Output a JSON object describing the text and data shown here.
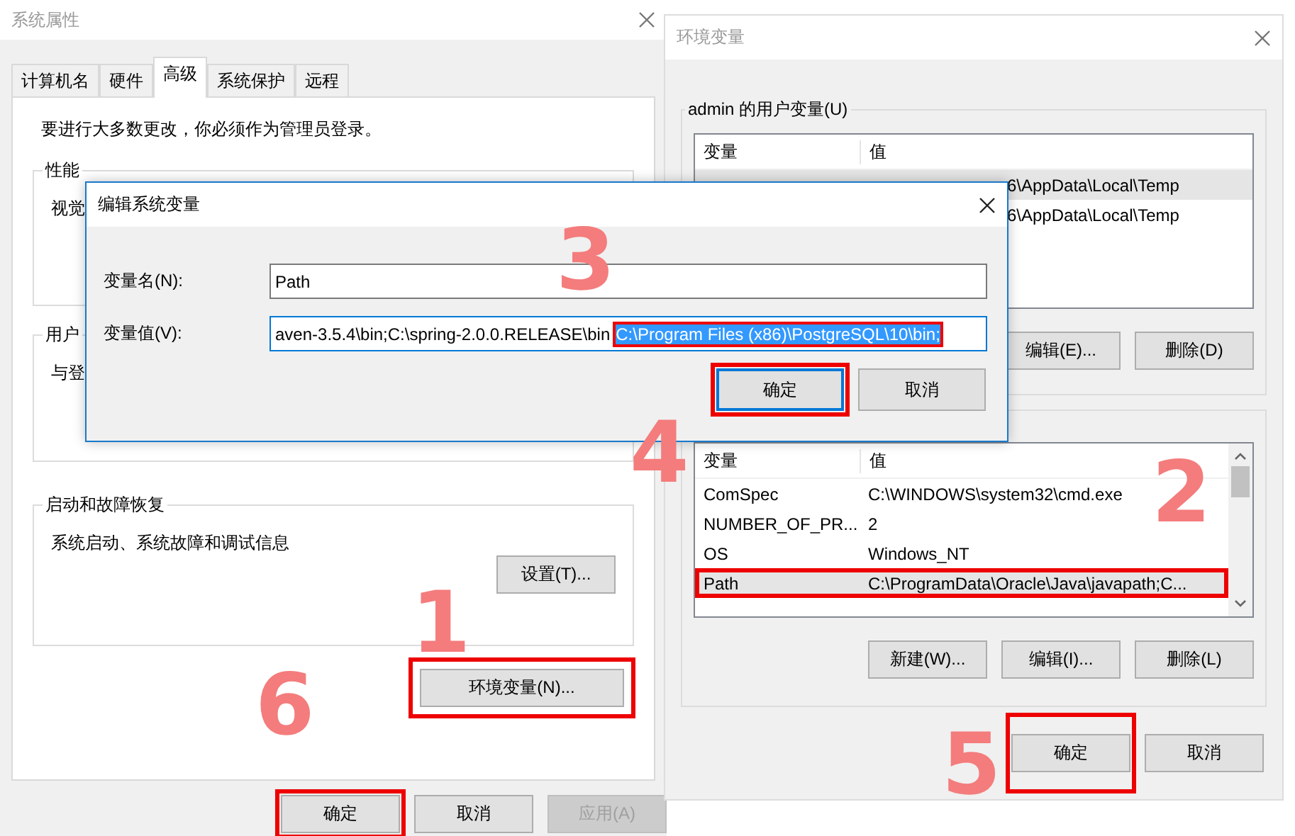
{
  "system_properties": {
    "title": "系统属性",
    "tabs": [
      {
        "label": "计算机名",
        "selected": false
      },
      {
        "label": "硬件",
        "selected": false
      },
      {
        "label": "高级",
        "selected": true
      },
      {
        "label": "系统保护",
        "selected": false
      },
      {
        "label": "远程",
        "selected": false
      }
    ],
    "admin_note": "要进行大多数更改，你必须作为管理员登录。",
    "performance": {
      "title": "性能",
      "text": "视觉"
    },
    "user_profiles": {
      "title": "用户",
      "text": "与登"
    },
    "startup_recovery": {
      "title": "启动和故障恢复",
      "text": "系统启动、系统故障和调试信息",
      "button": "设置(T)..."
    },
    "env_button": {
      "label": "环境变量(N)...",
      "highlighted": true,
      "step": "1"
    },
    "buttons": [
      {
        "label": "确定",
        "disabled": false,
        "highlighted": true,
        "step": "6"
      },
      {
        "label": "取消",
        "disabled": false,
        "highlighted": false
      },
      {
        "label": "应用(A)",
        "disabled": true,
        "highlighted": false
      }
    ]
  },
  "environment_variables": {
    "title": "环境变量",
    "user_group": {
      "title": "admin 的用户变量(U)",
      "columns": [
        "变量",
        "值"
      ],
      "rows": [
        {
          "value": "6\\AppData\\Local\\Temp",
          "selected": true
        },
        {
          "value": "6\\AppData\\Local\\Temp",
          "selected": false
        }
      ],
      "buttons": [
        "编辑(E)...",
        "删除(D)"
      ]
    },
    "system_group": {
      "columns": [
        "变量",
        "值"
      ],
      "rows": [
        {
          "name": "ComSpec",
          "value": "C:\\WINDOWS\\system32\\cmd.exe",
          "selected": false,
          "highlighted": false
        },
        {
          "name": "NUMBER_OF_PR...",
          "value": "2",
          "selected": false,
          "highlighted": false
        },
        {
          "name": "OS",
          "value": "Windows_NT",
          "selected": false,
          "highlighted": false
        },
        {
          "name": "Path",
          "value": "C:\\ProgramData\\Oracle\\Java\\javapath;C...",
          "selected": true,
          "highlighted": true,
          "step": "2"
        }
      ],
      "buttons": [
        "新建(W)...",
        "编辑(I)...",
        "删除(L)"
      ]
    },
    "buttons": [
      {
        "label": "确定",
        "highlighted": true,
        "step": "5"
      },
      {
        "label": "取消",
        "highlighted": false
      }
    ]
  },
  "edit_dialog": {
    "title": "编辑系统变量",
    "name_field": {
      "label": "变量名(N):",
      "value": "Path"
    },
    "value_field": {
      "label": "变量值(V):",
      "value": "aven-3.5.4\\bin;C:\\spring-2.0.0.RELEASE\\bin",
      "selection": "C:\\Program Files (x86)\\PostgreSQL\\10\\bin;",
      "highlighted": true,
      "step": "3"
    },
    "buttons": [
      {
        "label": "确定",
        "focused": true,
        "highlighted": true,
        "step": "4"
      },
      {
        "label": "取消",
        "focused": false,
        "highlighted": false
      }
    ]
  }
}
